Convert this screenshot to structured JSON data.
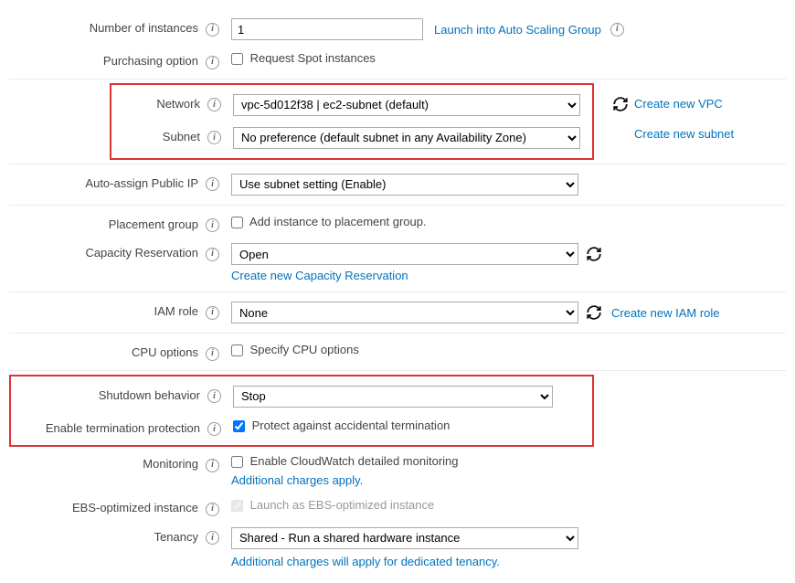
{
  "instances": {
    "label": "Number of instances",
    "value": "1",
    "launch_asg": "Launch into Auto Scaling Group"
  },
  "purchasing": {
    "label": "Purchasing option",
    "checkbox": "Request Spot instances"
  },
  "network": {
    "label": "Network",
    "value": "vpc-5d012f38 | ec2-subnet (default)",
    "create": "Create new VPC"
  },
  "subnet": {
    "label": "Subnet",
    "value": "No preference (default subnet in any Availability Zone)",
    "create": "Create new subnet"
  },
  "publicip": {
    "label": "Auto-assign Public IP",
    "value": "Use subnet setting (Enable)"
  },
  "placement": {
    "label": "Placement group",
    "checkbox": "Add instance to placement group."
  },
  "capacity": {
    "label": "Capacity Reservation",
    "value": "Open",
    "create": "Create new Capacity Reservation"
  },
  "iam": {
    "label": "IAM role",
    "value": "None",
    "create": "Create new IAM role"
  },
  "cpu": {
    "label": "CPU options",
    "checkbox": "Specify CPU options"
  },
  "shutdown": {
    "label": "Shutdown behavior",
    "value": "Stop"
  },
  "termprot": {
    "label": "Enable termination protection",
    "checkbox": "Protect against accidental termination"
  },
  "monitoring": {
    "label": "Monitoring",
    "checkbox": "Enable CloudWatch detailed monitoring",
    "note": "Additional charges apply."
  },
  "ebs": {
    "label": "EBS-optimized instance",
    "checkbox": "Launch as EBS-optimized instance"
  },
  "tenancy": {
    "label": "Tenancy",
    "value": "Shared - Run a shared hardware instance",
    "note": "Additional charges will apply for dedicated tenancy."
  }
}
